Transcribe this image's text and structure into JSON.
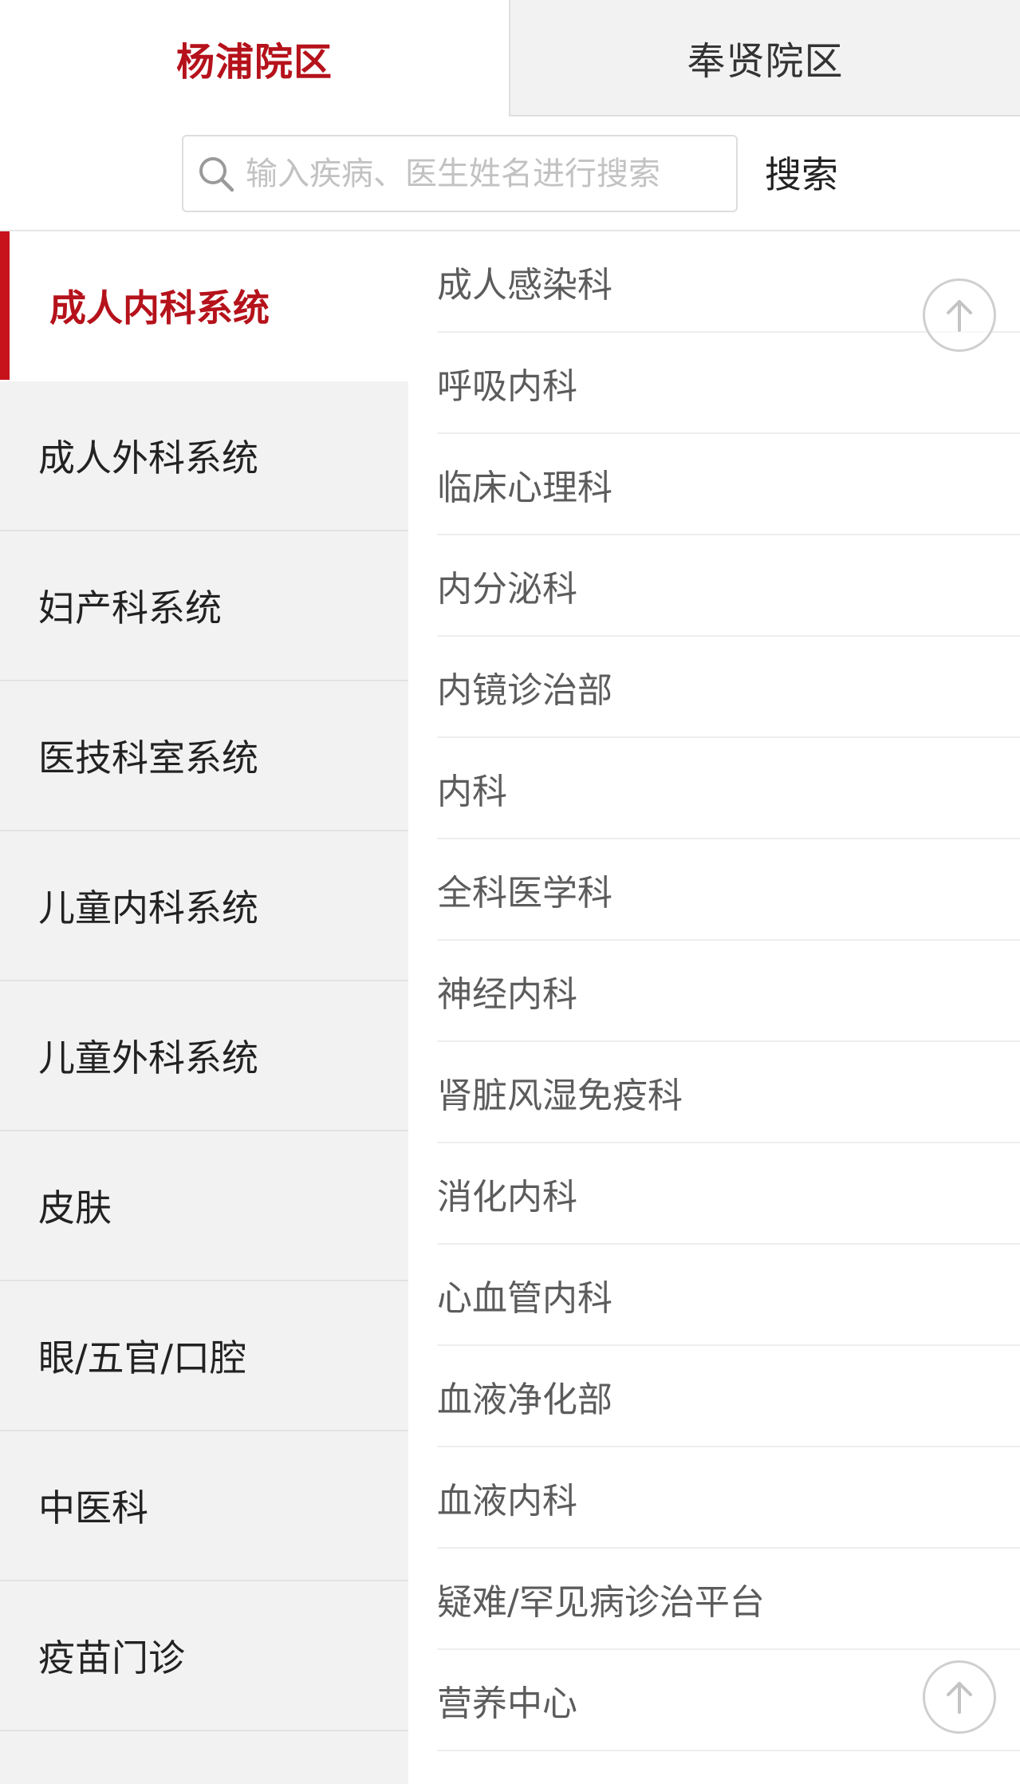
{
  "campus_tabs": {
    "active_label": "杨浦院区",
    "inactive_label": "奉贤院区"
  },
  "search": {
    "placeholder": "输入疾病、医生姓名进行搜索",
    "button_label": "搜索"
  },
  "categories": [
    {
      "label": "成人内科系统"
    },
    {
      "label": "成人外科系统"
    },
    {
      "label": "妇产科系统"
    },
    {
      "label": "医技科室系统"
    },
    {
      "label": "儿童内科系统"
    },
    {
      "label": "儿童外科系统"
    },
    {
      "label": "皮肤"
    },
    {
      "label": "眼/五官/口腔"
    },
    {
      "label": "中医科"
    },
    {
      "label": "疫苗门诊"
    }
  ],
  "departments": [
    {
      "label": "成人感染科"
    },
    {
      "label": "呼吸内科"
    },
    {
      "label": "临床心理科"
    },
    {
      "label": "内分泌科"
    },
    {
      "label": "内镜诊治部"
    },
    {
      "label": "内科"
    },
    {
      "label": "全科医学科"
    },
    {
      "label": "神经内科"
    },
    {
      "label": "肾脏风湿免疫科"
    },
    {
      "label": "消化内科"
    },
    {
      "label": "心血管内科"
    },
    {
      "label": "血液净化部"
    },
    {
      "label": "血液内科"
    },
    {
      "label": "疑难/罕见病诊治平台"
    },
    {
      "label": "营养中心"
    }
  ],
  "icons": {
    "search": "search-icon",
    "back_to_top": "arrow-up-circle-icon"
  },
  "colors": {
    "accent": "#b5121b",
    "sidebar_bg": "#f2f2f2"
  }
}
